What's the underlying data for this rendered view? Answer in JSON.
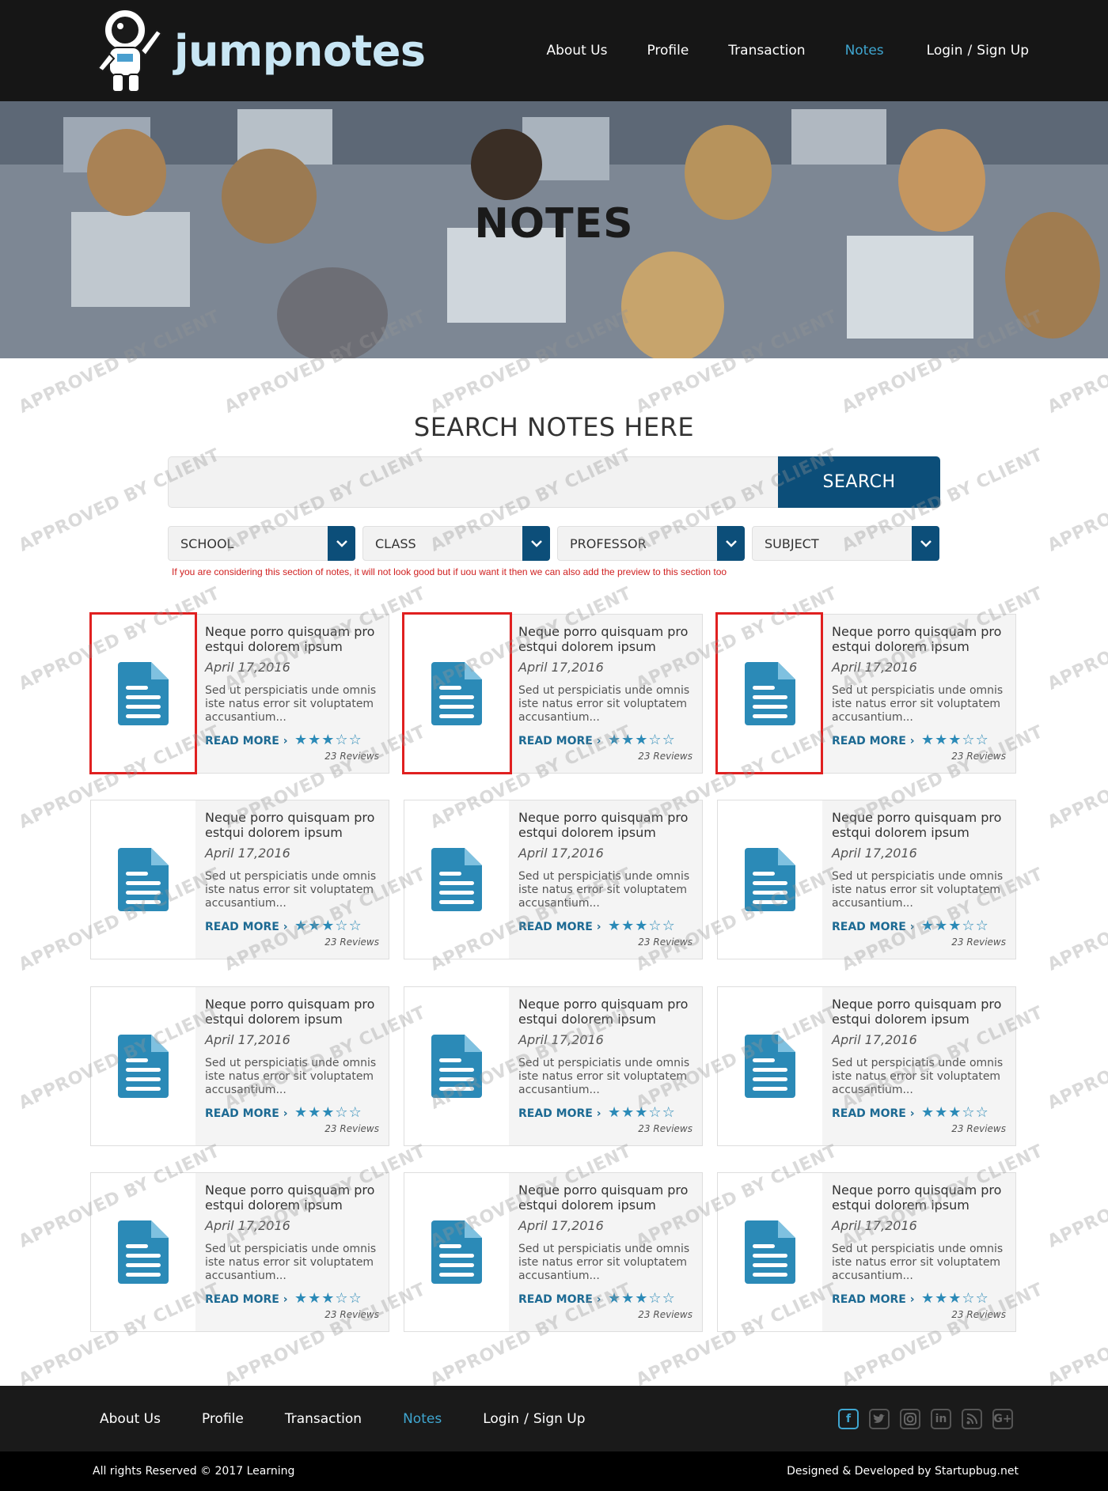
{
  "header": {
    "logo_text": "jumpnotes",
    "nav": [
      {
        "label": "About Us",
        "active": false
      },
      {
        "label": "Profile",
        "active": false
      },
      {
        "label": "Transaction",
        "active": false
      },
      {
        "label": "Notes",
        "active": true
      }
    ],
    "login": "Login",
    "separator": "/",
    "signup": "Sign Up"
  },
  "hero": {
    "title": "NOTES"
  },
  "search": {
    "title": "SEARCH NOTES HERE",
    "placeholder": "",
    "button": "SEARCH",
    "filters": [
      "SCHOOL",
      "CLASS",
      "PROFESSOR",
      "SUBJECT"
    ],
    "annotation": "If you are considering this section of notes, it will not look good but if uou want it then we can also add the preview to this section too"
  },
  "cards": [
    {
      "title": "Neque porro quisquam pro estqui dolorem ipsum",
      "date": "April 17,2016",
      "desc": "Sed ut perspiciatis unde omnis iste natus error sit voluptatem accusantium...",
      "read_more": "READ MORE ›",
      "rating": 3,
      "reviews": "23 Reviews"
    },
    {
      "title": "Neque porro quisquam pro estqui dolorem ipsum",
      "date": "April 17,2016",
      "desc": "Sed ut perspiciatis unde omnis iste natus error sit voluptatem accusantium...",
      "read_more": "READ MORE ›",
      "rating": 3,
      "reviews": "23 Reviews"
    },
    {
      "title": "Neque porro quisquam pro estqui dolorem ipsum",
      "date": "April 17,2016",
      "desc": "Sed ut perspiciatis unde omnis iste natus error sit voluptatem accusantium...",
      "read_more": "READ MORE ›",
      "rating": 3,
      "reviews": "23 Reviews"
    },
    {
      "title": "Neque porro quisquam pro estqui dolorem ipsum",
      "date": "April 17,2016",
      "desc": "Sed ut perspiciatis unde omnis iste natus error sit voluptatem accusantium...",
      "read_more": "READ MORE ›",
      "rating": 3,
      "reviews": "23 Reviews"
    },
    {
      "title": "Neque porro quisquam pro estqui dolorem ipsum",
      "date": "April 17,2016",
      "desc": "Sed ut perspiciatis unde omnis iste natus error sit voluptatem accusantium...",
      "read_more": "READ MORE ›",
      "rating": 3,
      "reviews": "23 Reviews"
    },
    {
      "title": "Neque porro quisquam pro estqui dolorem ipsum",
      "date": "April 17,2016",
      "desc": "Sed ut perspiciatis unde omnis iste natus error sit voluptatem accusantium...",
      "read_more": "READ MORE ›",
      "rating": 3,
      "reviews": "23 Reviews"
    },
    {
      "title": "Neque porro quisquam pro estqui dolorem ipsum",
      "date": "April 17,2016",
      "desc": "Sed ut perspiciatis unde omnis iste natus error sit voluptatem accusantium...",
      "read_more": "READ MORE ›",
      "rating": 3,
      "reviews": "23 Reviews"
    },
    {
      "title": "Neque porro quisquam pro estqui dolorem ipsum",
      "date": "April 17,2016",
      "desc": "Sed ut perspiciatis unde omnis iste natus error sit voluptatem accusantium...",
      "read_more": "READ MORE ›",
      "rating": 3,
      "reviews": "23 Reviews"
    },
    {
      "title": "Neque porro quisquam pro estqui dolorem ipsum",
      "date": "April 17,2016",
      "desc": "Sed ut perspiciatis unde omnis iste natus error sit voluptatem accusantium...",
      "read_more": "READ MORE ›",
      "rating": 3,
      "reviews": "23 Reviews"
    },
    {
      "title": "Neque porro quisquam pro estqui dolorem ipsum",
      "date": "April 17,2016",
      "desc": "Sed ut perspiciatis unde omnis iste natus error sit voluptatem accusantium...",
      "read_more": "READ MORE ›",
      "rating": 3,
      "reviews": "23 Reviews"
    },
    {
      "title": "Neque porro quisquam pro estqui dolorem ipsum",
      "date": "April 17,2016",
      "desc": "Sed ut perspiciatis unde omnis iste natus error sit voluptatem accusantium...",
      "read_more": "READ MORE ›",
      "rating": 3,
      "reviews": "23 Reviews"
    },
    {
      "title": "Neque porro quisquam pro estqui dolorem ipsum",
      "date": "April 17,2016",
      "desc": "Sed ut perspiciatis unde omnis iste natus error sit voluptatem accusantium...",
      "read_more": "READ MORE ›",
      "rating": 3,
      "reviews": "23 Reviews"
    }
  ],
  "footer": {
    "nav": [
      {
        "label": "About Us",
        "active": false
      },
      {
        "label": "Profile",
        "active": false
      },
      {
        "label": "Transaction",
        "active": false
      },
      {
        "label": "Notes",
        "active": true
      }
    ],
    "login": "Login",
    "separator": "/",
    "signup": "Sign Up",
    "social_icons": [
      "facebook-icon",
      "twitter-icon",
      "instagram-icon",
      "linkedin-icon",
      "rss-icon",
      "google-plus-icon"
    ],
    "copyright": "All rights Reserved © 2017 Learning",
    "credit": "Designed & Developed by Startupbug.net"
  },
  "watermark": "APPROVED BY CLIENT",
  "colors": {
    "header_bg": "#161616",
    "accent": "#3fa6d0",
    "button": "#0c4e79",
    "icon": "#2b8ab7",
    "annotation_red": "#e02020"
  }
}
